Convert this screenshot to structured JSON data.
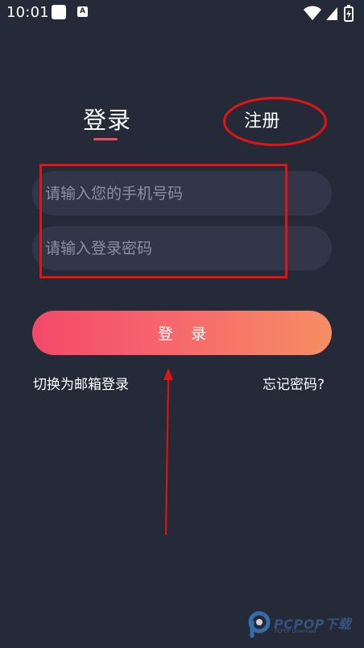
{
  "status_bar": {
    "time": "10:01",
    "notification_badge": "A",
    "icons": [
      "square-notification-icon",
      "a-notification-icon",
      "wifi-icon",
      "cellular-signal-icon",
      "battery-charging-icon"
    ],
    "icon_color": "#ffffff"
  },
  "tabs": {
    "login_label": "登录",
    "register_label": "注册",
    "active": "login",
    "active_underline_color": "#f04a63"
  },
  "form": {
    "phone_placeholder": "请输入您的手机号码",
    "phone_value": "",
    "password_placeholder": "请输入登录密码",
    "password_value": ""
  },
  "actions": {
    "login_button": "登 录",
    "switch_email_login": "切换为邮箱登录",
    "forgot_password": "忘记密码?"
  },
  "annotations": {
    "color": "#e51212"
  },
  "watermark": {
    "brand": "PCPOP下载",
    "subtitle": "PCPOP Download",
    "color": "#3c5f92"
  },
  "colors": {
    "background": "#252a39",
    "input_background": "#313748",
    "placeholder": "#8b90a0",
    "gradient_start": "#f4496a",
    "gradient_end": "#f58f63"
  }
}
